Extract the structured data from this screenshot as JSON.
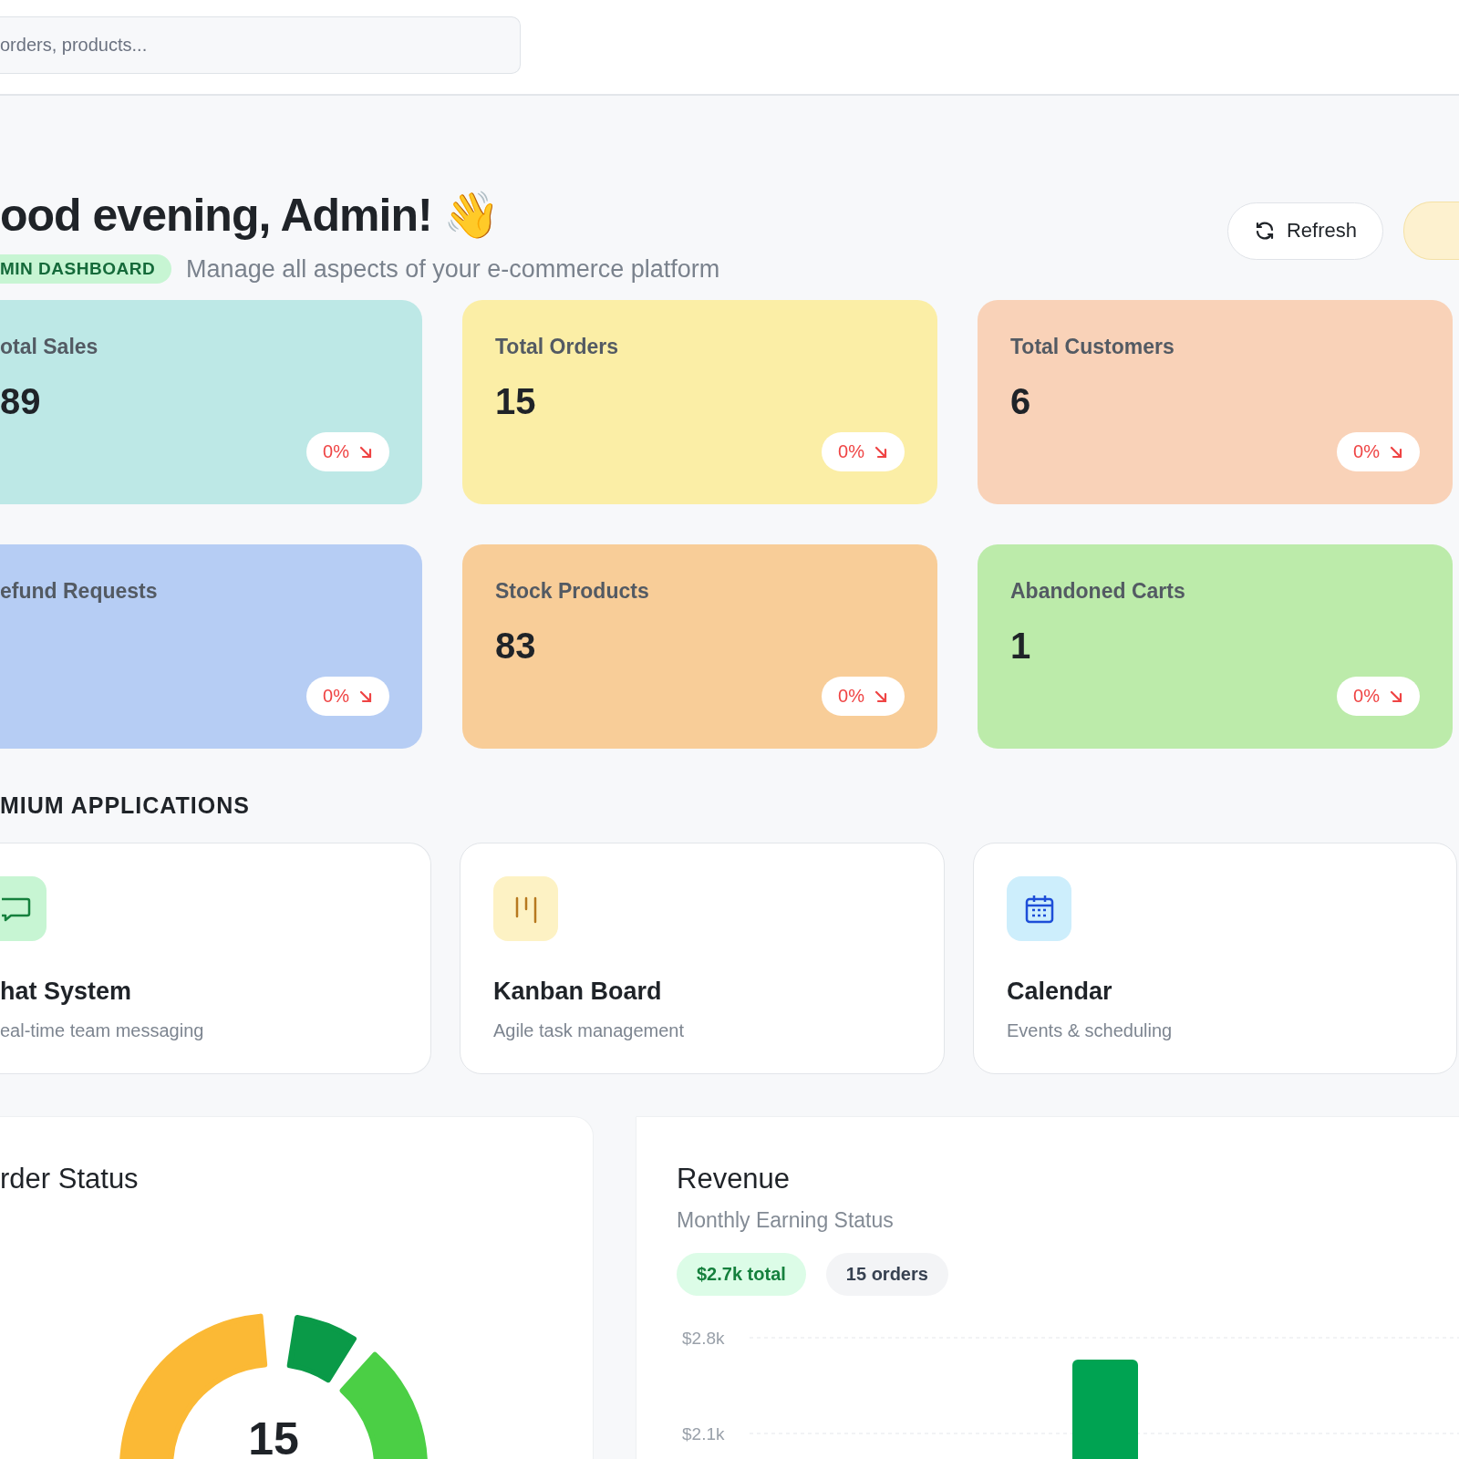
{
  "header": {
    "search": {
      "placeholder": "orders, products..."
    }
  },
  "greeting": {
    "title": "ood evening, Admin! 👋",
    "badge": "MIN DASHBOARD",
    "subtitle": "Manage all aspects of your e-commerce platform",
    "refresh_button": "Refresh"
  },
  "stats": [
    {
      "label": "otal Sales",
      "value": "89",
      "trend": "0%",
      "color": "#bde8e6"
    },
    {
      "label": "Total Orders",
      "value": "15",
      "trend": "0%",
      "color": "#fbeea6"
    },
    {
      "label": "Total Customers",
      "value": "6",
      "trend": "0%",
      "color": "#f9d2b8"
    },
    {
      "label": "efund Requests",
      "trend": "0%",
      "color": "#b6cdf4"
    },
    {
      "label": "Stock Products",
      "value": "83",
      "trend": "0%",
      "color": "#f8cd98"
    },
    {
      "label": "Abandoned Carts",
      "value": "1",
      "trend": "0%",
      "color": "#bcebaa"
    }
  ],
  "applications": {
    "title": "MIUM APPLICATIONS",
    "items": [
      {
        "kind": "chat",
        "name": "hat System",
        "description": "eal-time team messaging"
      },
      {
        "kind": "kanban",
        "name": "Kanban Board",
        "description": "Agile task management"
      },
      {
        "kind": "calendar",
        "name": "Calendar",
        "description": "Events & scheduling"
      }
    ]
  },
  "order_status": {
    "title": "rder Status",
    "center_value": "15"
  },
  "revenue": {
    "title": "Revenue",
    "subtitle": "Monthly Earning Status",
    "total_badge": "$2.7k total",
    "orders_badge": "15 orders",
    "chart_data": {
      "type": "bar",
      "values": [
        null,
        null,
        null,
        2640,
        null,
        null,
        null
      ],
      "ylim": [
        2100,
        2800
      ],
      "yticks": [
        {
          "value": 2800,
          "label": "$2.8k"
        },
        {
          "value": 2100,
          "label": "$2.1k"
        }
      ]
    }
  }
}
